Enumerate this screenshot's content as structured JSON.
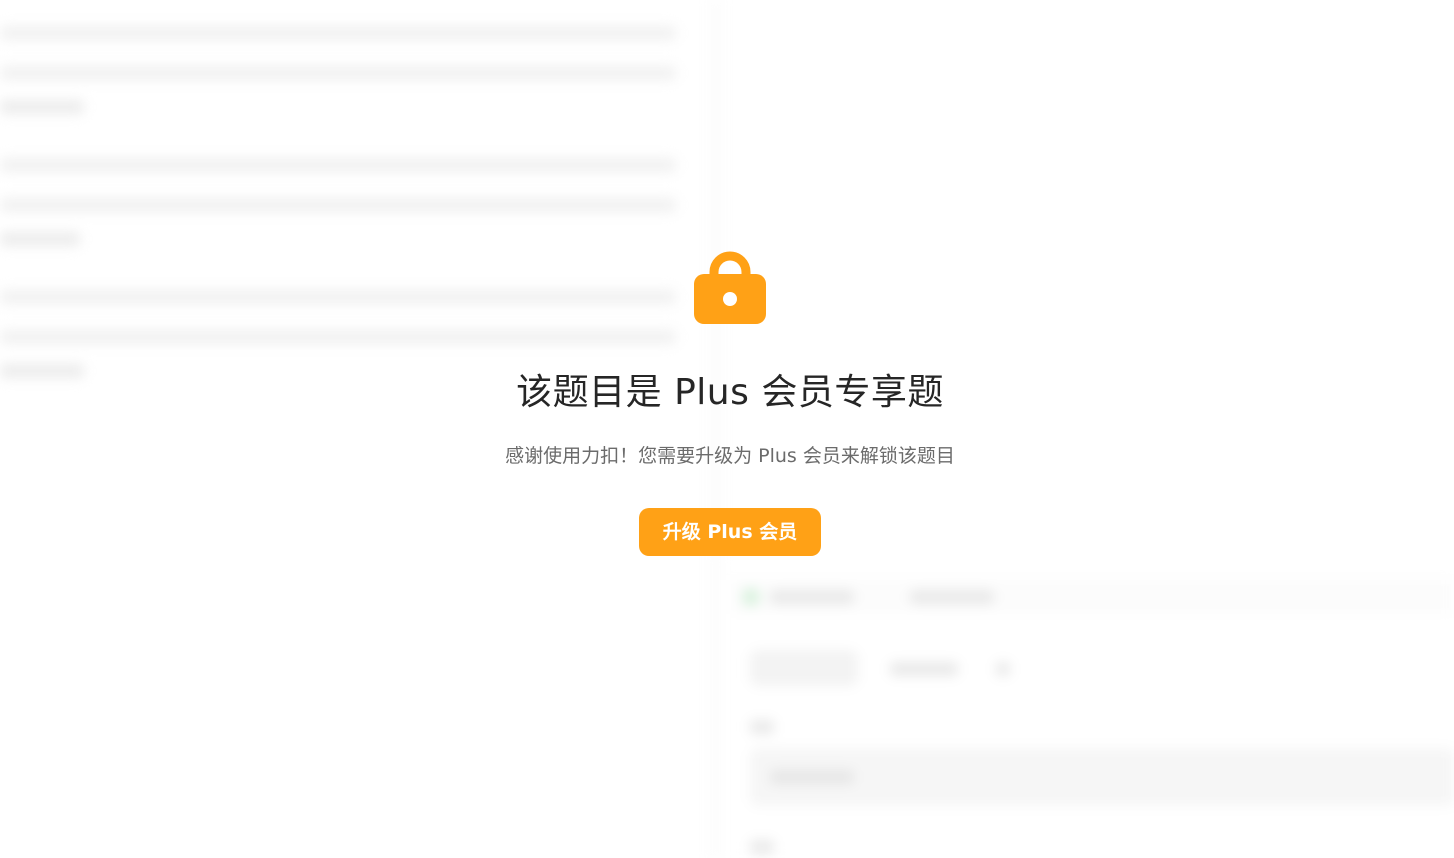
{
  "paywall": {
    "icon": "lock-icon",
    "title": "该题目是 Plus 会员专享题",
    "subtitle": "感谢使用力扣！您需要升级为 Plus 会员来解锁该题目",
    "upgrade_label": "升级 Plus 会员"
  },
  "colors": {
    "accent": "#ffa116",
    "title": "#262626",
    "subtitle": "#6b6b6b",
    "background": "#ffffff"
  }
}
